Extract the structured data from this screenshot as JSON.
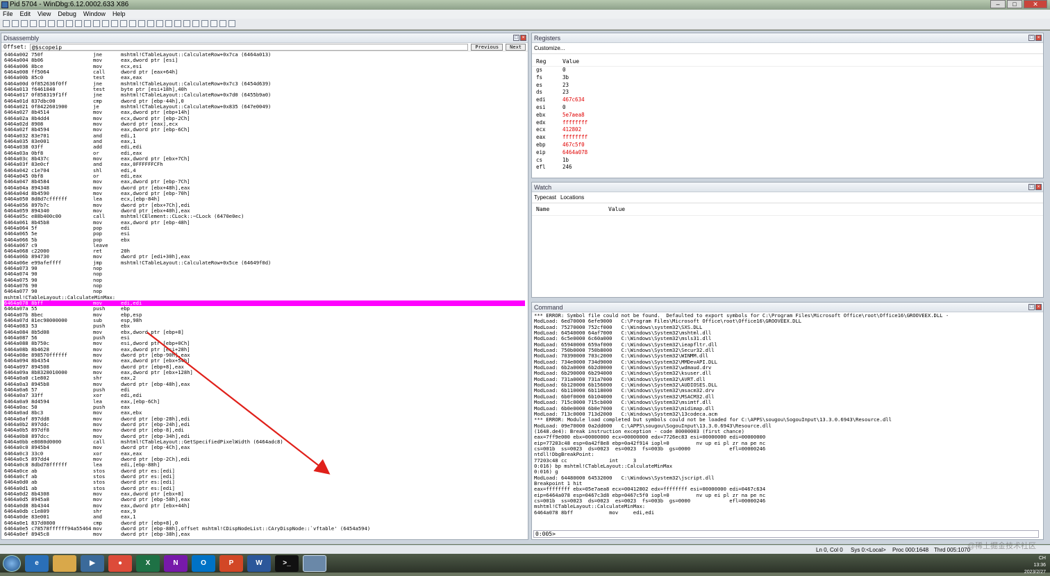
{
  "window": {
    "title": "Pid 5704 - WinDbg:6.12.0002.633 X86"
  },
  "menu": [
    "File",
    "Edit",
    "View",
    "Debug",
    "Window",
    "Help"
  ],
  "disasm": {
    "title": "Disassembly",
    "offset_label": "Offset:",
    "offset_value": "@$scopeip",
    "prev_label": "Previous",
    "next_label": "Next",
    "lines": [
      {
        "addr": "6464a002 750f",
        "mn": "jne",
        "op": "mshtml!CTableLayout::CalculateRow+0x7ca (6464a013)"
      },
      {
        "addr": "6464a004 8b06",
        "mn": "mov",
        "op": "eax,dword ptr [esi]"
      },
      {
        "addr": "6464a006 8bce",
        "mn": "mov",
        "op": "ecx,esi"
      },
      {
        "addr": "6464a008 ff5064",
        "mn": "call",
        "op": "dword ptr [eax+64h]"
      },
      {
        "addr": "6464a00b 85c0",
        "mn": "test",
        "op": "eax,eax"
      },
      {
        "addr": "6464a00d 0f852636f0ff",
        "mn": "jne",
        "op": "mshtml!CTableLayout::CalculateRow+0x7c3 (6454d639)"
      },
      {
        "addr": "6464a013 f6461840",
        "mn": "test",
        "op": "byte ptr [esi+18h],40h"
      },
      {
        "addr": "6464a017 0f858319f1ff",
        "mn": "jne",
        "op": "mshtml!CTableLayout::CalculateRow+0x7d0 (6455b9a0)"
      },
      {
        "addr": "6464a01d 837dbc00",
        "mn": "cmp",
        "op": "dword ptr [ebp-44h],0"
      },
      {
        "addr": "6464a021 0f8422601900",
        "mn": "je",
        "op": "mshtml!CTableLayout::CalculateRow+0x835 (647e0049)"
      },
      {
        "addr": "6464a027 8b4514",
        "mn": "mov",
        "op": "eax,dword ptr [ebp+14h]"
      },
      {
        "addr": "6464a02a 8b4dd4",
        "mn": "mov",
        "op": "ecx,dword ptr [ebp-2Ch]"
      },
      {
        "addr": "6464a02d 8908",
        "mn": "mov",
        "op": "dword ptr [eax],ecx"
      },
      {
        "addr": "6464a02f 8b4594",
        "mn": "mov",
        "op": "eax,dword ptr [ebp-6Ch]"
      },
      {
        "addr": "6464a032 83e701",
        "mn": "and",
        "op": "edi,1"
      },
      {
        "addr": "6464a035 83e001",
        "mn": "and",
        "op": "eax,1"
      },
      {
        "addr": "6464a038 03ff",
        "mn": "add",
        "op": "edi,edi"
      },
      {
        "addr": "6464a03a 0bf8",
        "mn": "or",
        "op": "edi,eax"
      },
      {
        "addr": "6464a03c 8b437c",
        "mn": "mov",
        "op": "eax,dword ptr [ebx+7Ch]"
      },
      {
        "addr": "6464a03f 83e0cf",
        "mn": "and",
        "op": "eax,0FFFFFFCFh"
      },
      {
        "addr": "6464a042 c1e704",
        "mn": "shl",
        "op": "edi,4"
      },
      {
        "addr": "6464a045 0bf8",
        "mn": "or",
        "op": "edi,eax"
      },
      {
        "addr": "6464a047 8b4584",
        "mn": "mov",
        "op": "eax,dword ptr [ebp-7Ch]"
      },
      {
        "addr": "6464a04a 894348",
        "mn": "mov",
        "op": "dword ptr [ebx+48h],eax"
      },
      {
        "addr": "6464a04d 8b4590",
        "mn": "mov",
        "op": "eax,dword ptr [ebp-70h]"
      },
      {
        "addr": "6464a050 8d8d7cffffff",
        "mn": "lea",
        "op": "ecx,[ebp-84h]"
      },
      {
        "addr": "6464a056 897b7c",
        "mn": "mov",
        "op": "dword ptr [ebx+7Ch],edi"
      },
      {
        "addr": "6464a059 894340",
        "mn": "mov",
        "op": "dword ptr [ebx+40h],eax"
      },
      {
        "addr": "6464a05c e88b400c00",
        "mn": "call",
        "op": "mshtml!CElement::CLock::~CLock (6470e0ec)"
      },
      {
        "addr": "6464a061 8b45b8",
        "mn": "mov",
        "op": "eax,dword ptr [ebp-48h]"
      },
      {
        "addr": "6464a064 5f",
        "mn": "pop",
        "op": "edi"
      },
      {
        "addr": "6464a065 5e",
        "mn": "pop",
        "op": "esi"
      },
      {
        "addr": "6464a066 5b",
        "mn": "pop",
        "op": "ebx"
      },
      {
        "addr": "6464a067 c9",
        "mn": "leave",
        "op": ""
      },
      {
        "addr": "6464a068 c22000",
        "mn": "ret",
        "op": "20h"
      },
      {
        "addr": "6464a06b 894730",
        "mn": "mov",
        "op": "dword ptr [edi+30h],eax"
      },
      {
        "addr": "6464a06e e99afeffff",
        "mn": "jmp",
        "op": "mshtml!CTableLayout::CalculateRow+0x5ce (64649f0d)"
      },
      {
        "addr": "6464a073 90",
        "mn": "nop",
        "op": ""
      },
      {
        "addr": "6464a074 90",
        "mn": "nop",
        "op": ""
      },
      {
        "addr": "6464a075 90",
        "mn": "nop",
        "op": ""
      },
      {
        "addr": "6464a076 90",
        "mn": "nop",
        "op": ""
      },
      {
        "addr": "6464a077 90",
        "mn": "nop",
        "op": ""
      },
      {
        "addr": "mshtml!CTableLayout::CalculateMinMax:",
        "mn": "",
        "op": "",
        "label": true
      },
      {
        "addr": "6464a078 8bff",
        "mn": "mov",
        "op": "edi,edi",
        "hl": true
      },
      {
        "addr": "6464a07a 55",
        "mn": "push",
        "op": "ebp"
      },
      {
        "addr": "6464a07b 8bec",
        "mn": "mov",
        "op": "ebp,esp"
      },
      {
        "addr": "6464a07d 81ec98000000",
        "mn": "sub",
        "op": "esp,98h"
      },
      {
        "addr": "6464a083 53",
        "mn": "push",
        "op": "ebx"
      },
      {
        "addr": "6464a084 8b5d08",
        "mn": "mov",
        "op": "ebx,dword ptr [ebp+8]"
      },
      {
        "addr": "6464a087 56",
        "mn": "push",
        "op": "esi"
      },
      {
        "addr": "6464a088 8b750c",
        "mn": "mov",
        "op": "esi,dword ptr [ebp+0Ch]"
      },
      {
        "addr": "6464a08b 8b4628",
        "mn": "mov",
        "op": "eax,dword ptr [esi+28h]"
      },
      {
        "addr": "6464a08e 898570ffffff",
        "mn": "mov",
        "op": "dword ptr [ebp-90h],eax"
      },
      {
        "addr": "6464a094 8b4354",
        "mn": "mov",
        "op": "eax,dword ptr [ebx+54h]"
      },
      {
        "addr": "6464a097 894508",
        "mn": "mov",
        "op": "dword ptr [ebp+8],eax"
      },
      {
        "addr": "6464a09a 8b8328010000",
        "mn": "mov",
        "op": "eax,dword ptr [ebx+128h]"
      },
      {
        "addr": "6464a0a0 c1e802",
        "mn": "shr",
        "op": "eax,2"
      },
      {
        "addr": "6464a0a3 8945b8",
        "mn": "mov",
        "op": "dword ptr [ebp-48h],eax"
      },
      {
        "addr": "6464a0a6 57",
        "mn": "push",
        "op": "edi"
      },
      {
        "addr": "6464a0a7 33ff",
        "mn": "xor",
        "op": "edi,edi"
      },
      {
        "addr": "6464a0a9 8d4594",
        "mn": "lea",
        "op": "eax,[ebp-6Ch]"
      },
      {
        "addr": "6464a0ac 50",
        "mn": "push",
        "op": "eax"
      },
      {
        "addr": "6464a0ad 8bc3",
        "mn": "mov",
        "op": "eax,ebx"
      },
      {
        "addr": "6464a0af 897dd8",
        "mn": "mov",
        "op": "dword ptr [ebp-28h],edi"
      },
      {
        "addr": "6464a0b2 897ddc",
        "mn": "mov",
        "op": "dword ptr [ebp-24h],edi"
      },
      {
        "addr": "6464a0b5 897df8",
        "mn": "mov",
        "op": "dword ptr [ebp-8],edi"
      },
      {
        "addr": "6464a0b8 897dcc",
        "mn": "mov",
        "op": "dword ptr [ebp-34h],edi"
      },
      {
        "addr": "6464a0bb e8080d0000",
        "mn": "call",
        "op": "mshtml!CTableLayout::GetSpecifiedPixelWidth (6464adc8)"
      },
      {
        "addr": "6464a0c0 8945b4",
        "mn": "mov",
        "op": "dword ptr [ebp-4Ch],eax"
      },
      {
        "addr": "6464a0c3 33c0",
        "mn": "xor",
        "op": "eax,eax"
      },
      {
        "addr": "6464a0c5 897dd4",
        "mn": "mov",
        "op": "dword ptr [ebp-2Ch],edi"
      },
      {
        "addr": "6464a0c8 8dbd78ffffff",
        "mn": "lea",
        "op": "edi,[ebp-88h]"
      },
      {
        "addr": "6464a0ce ab",
        "mn": "stos",
        "op": "dword ptr es:[edi]"
      },
      {
        "addr": "6464a0cf ab",
        "mn": "stos",
        "op": "dword ptr es:[edi]"
      },
      {
        "addr": "6464a0d0 ab",
        "mn": "stos",
        "op": "dword ptr es:[edi]"
      },
      {
        "addr": "6464a0d1 ab",
        "mn": "stos",
        "op": "dword ptr es:[edi]"
      },
      {
        "addr": "6464a0d2 8b4308",
        "mn": "mov",
        "op": "eax,dword ptr [ebx+8]"
      },
      {
        "addr": "6464a0d5 8945a8",
        "mn": "mov",
        "op": "dword ptr [ebp-58h],eax"
      },
      {
        "addr": "6464a0d8 8b4344",
        "mn": "mov",
        "op": "eax,dword ptr [ebx+44h]"
      },
      {
        "addr": "6464a0db c1e809",
        "mn": "shr",
        "op": "eax,9"
      },
      {
        "addr": "6464a0de 83e001",
        "mn": "and",
        "op": "eax,1"
      },
      {
        "addr": "6464a0e1 837d0800",
        "mn": "cmp",
        "op": "dword ptr [ebp+8],0"
      },
      {
        "addr": "6464a0e5 c78578ffffff94a55464",
        "mn": "mov",
        "op": "dword ptr [ebp-88h],offset mshtml!CDispNodeList::CAryDispNode::`vftable' (6454a594)"
      },
      {
        "addr": "6464a0ef 8945c8",
        "mn": "mov",
        "op": "dword ptr [ebp-38h],eax"
      }
    ]
  },
  "registers": {
    "title": "Registers",
    "customize": "Customize...",
    "col_reg": "Reg",
    "col_value": "Value",
    "items": [
      {
        "name": "gs",
        "value": "0",
        "changed": false
      },
      {
        "name": "fs",
        "value": "3b",
        "changed": false
      },
      {
        "name": "es",
        "value": "23",
        "changed": false
      },
      {
        "name": "ds",
        "value": "23",
        "changed": false
      },
      {
        "name": "edi",
        "value": "467c634",
        "changed": true
      },
      {
        "name": "esi",
        "value": "0",
        "changed": false
      },
      {
        "name": "ebx",
        "value": "5e7aea8",
        "changed": true
      },
      {
        "name": "edx",
        "value": "ffffffff",
        "changed": true
      },
      {
        "name": "ecx",
        "value": "412802",
        "changed": true
      },
      {
        "name": "eax",
        "value": "ffffffff",
        "changed": true
      },
      {
        "name": "ebp",
        "value": "467c5f0",
        "changed": true
      },
      {
        "name": "eip",
        "value": "6464a078",
        "changed": true
      },
      {
        "name": "cs",
        "value": "1b",
        "changed": false
      },
      {
        "name": "efl",
        "value": "246",
        "changed": false
      }
    ]
  },
  "watch": {
    "title": "Watch",
    "tab_typecast": "Typecast",
    "tab_locations": "Locations",
    "col_name": "Name",
    "col_value": "Value"
  },
  "command": {
    "title": "Command",
    "lines": [
      "*** ERROR: Symbol file could not be found.  Defaulted to export symbols for C:\\Program Files\\Microsoft Office\\root\\Office16\\GROOVEEX.DLL -",
      "ModLoad: 6ed70000 6efe9000   C:\\Program Files\\Microsoft Office\\root\\Office16\\GROOVEEX.DLL",
      "ModLoad: 75270000 752cf000   C:\\Windows\\system32\\SXS.DLL",
      "ModLoad: 64540000 64af7000   C:\\Windows\\System32\\mshtml.dll",
      "ModLoad: 6c5e0000 6c60a000   C:\\Windows\\System32\\msls31.dll",
      "ModLoad: 65940000 659af000   C:\\Windows\\System32\\ieapfltr.dll",
      "ModLoad: 750b0000 750b8000   C:\\Windows\\System32\\Secur32.dll",
      "ModLoad: 70390000 703c2000   C:\\Windows\\System32\\WINMM.dll",
      "ModLoad: 734e0000 734d9000   C:\\Windows\\System32\\MMDevAPI.DLL",
      "ModLoad: 6b2a0000 6b2d0000   C:\\Windows\\System32\\wdmaud.drv",
      "ModLoad: 6b290000 6b294000   C:\\Windows\\System32\\ksuser.dll",
      "ModLoad: 731a0000 731a7000   C:\\Windows\\System32\\AVRT.dll",
      "ModLoad: 6b120000 6b156000   C:\\Windows\\System32\\AUDIOSES.DLL",
      "ModLoad: 6b110000 6b118000   C:\\Windows\\System32\\msacm32.drv",
      "ModLoad: 6b0f0000 6b104000   C:\\Windows\\System32\\MSACM32.dll",
      "ModLoad: 715c0000 715cb000   C:\\Windows\\System32\\msimtf.dll",
      "ModLoad: 6b0e0000 6b0e7000   C:\\Windows\\System32\\midimap.dll",
      "ModLoad: 713c0000 713d2000   C:\\Windows\\System32\\13codeca.acm",
      "*** ERROR: Module load completed but symbols could not be loaded for C:\\APPS\\sougou\\SogouInput\\13.3.0.6943\\Resource.dll",
      "ModLoad: 09e70000 0a2dd000   C:\\APPS\\sougou\\SogouInput\\13.3.0.6943\\Resource.dll",
      "(1648.de4): Break instruction exception - code 80000003 (first chance)",
      "eax=7ff9e000 ebx=00000000 ecx=00000000 edx=7726ec83 esi=00000000 edi=00000000",
      "eip=77203c48 esp=0a42f8e8 ebp=0a42f914 iopl=0         nv up ei pl zr na pe nc",
      "cs=001b  ss=0023  ds=0023  es=0023  fs=003b  gs=0000             efl=00000246",
      "ntdll!DbgBreakPoint:",
      "77203c48 cc              int     3",
      "0:016) bp mshtml!CTableLayout::CalculateMinMax",
      "0:016) g",
      "ModLoad: 64480000 64532000   C:\\Windows\\System32\\jscript.dll",
      "Breakpoint 1 hit",
      "eax=ffffffff ebx=05e7aea8 ecx=00412802 edx=ffffffff esi=00000000 edi=0467c634",
      "eip=6464a078 esp=0467c3d8 ebp=0467c5f0 iopl=0         nv up ei pl zr na pe nc",
      "cs=001b  ss=0023  ds=0023  es=0023  fs=003b  gs=0000             efl=00000246",
      "mshtml!CTableLayout::CalculateMinMax:",
      "6464a078 8bff            mov     edi,edi"
    ],
    "prompt": "0:005>"
  },
  "statusbar": {
    "pos": "Ln 0, Col 0",
    "sys": "Sys 0:<Local>",
    "proc": "Proc 000:1648",
    "thrd": "Thrd 005:1070"
  },
  "tray": {
    "time": "13:36",
    "date": "2023/2/27",
    "ime": "CH"
  },
  "taskbar": {
    "excel": "X",
    "onenote": "N",
    "outlook": "O",
    "ppt": "P",
    "word": "W"
  },
  "watermark": "@稀土掘金技术社区",
  "colors": {
    "highlight": "#ff00ff",
    "changed_reg": "#e00000",
    "arrow": "#e0201a"
  }
}
